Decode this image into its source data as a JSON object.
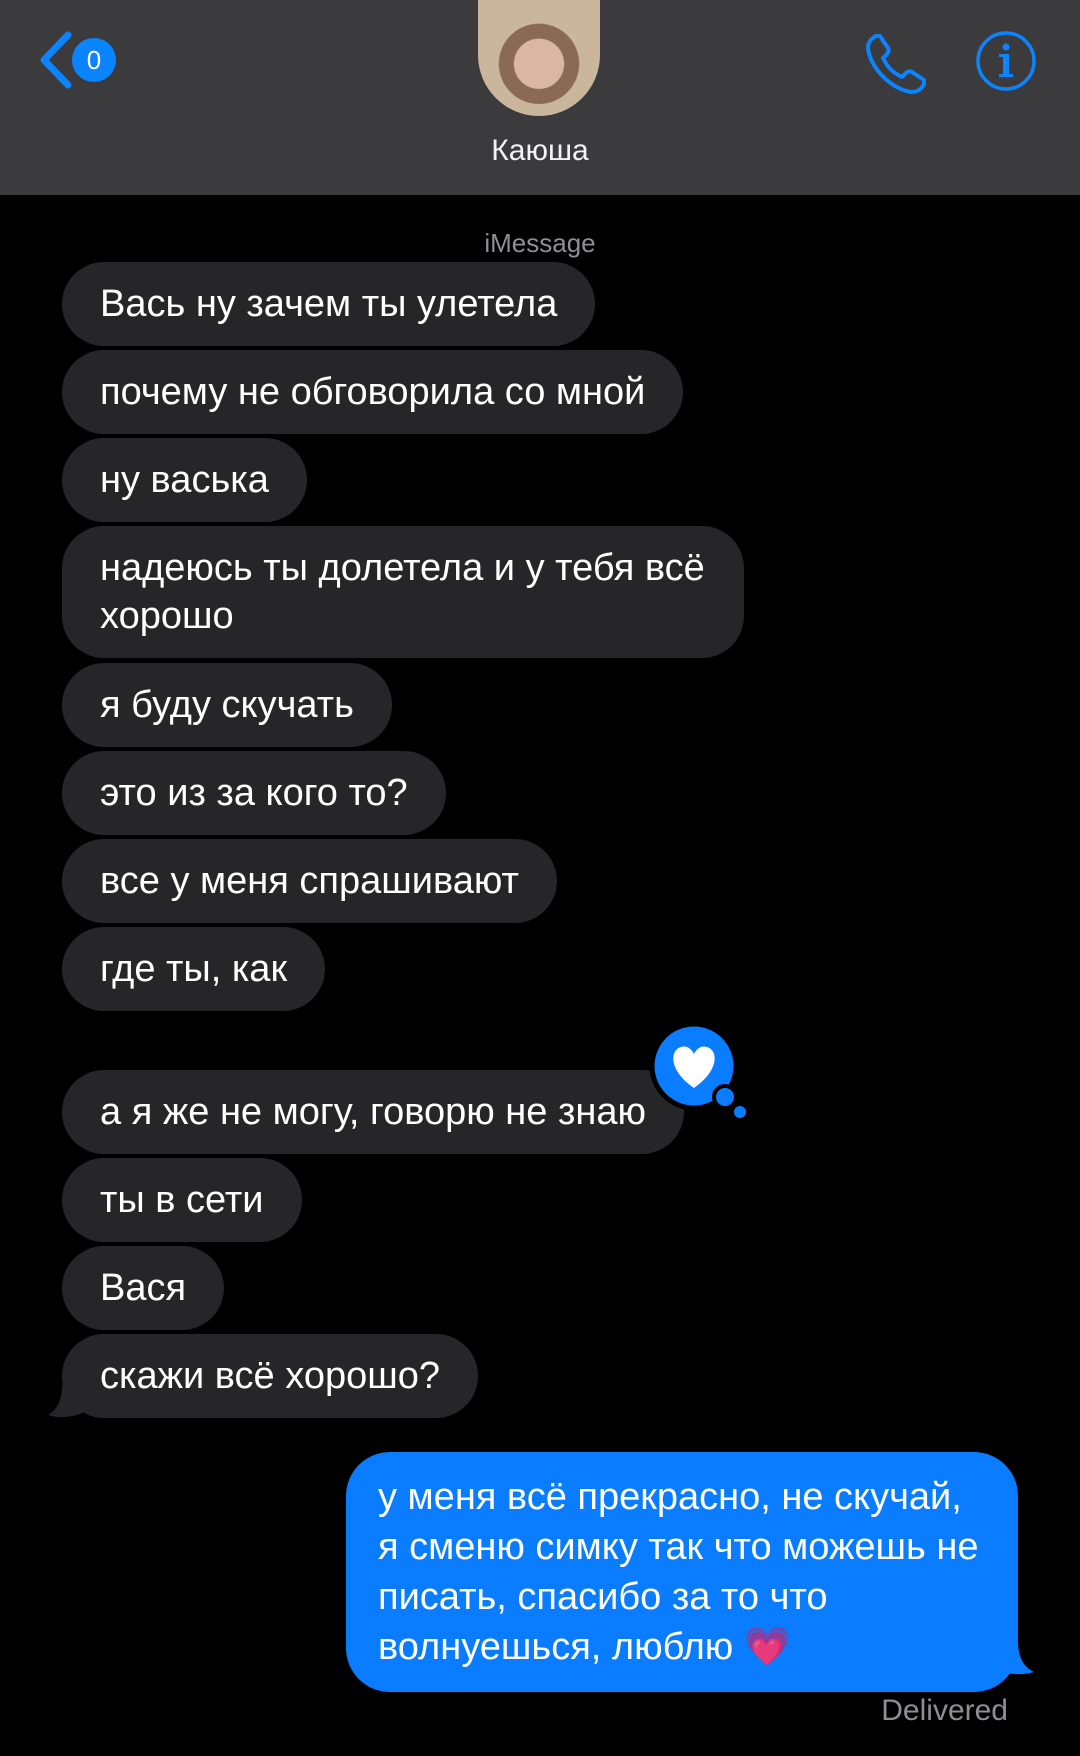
{
  "header": {
    "back_badge": "0",
    "contact_name": "Каюша",
    "accent_color": "#0a84ff",
    "icons": [
      "chevron-left-icon",
      "phone-icon",
      "info-icon"
    ]
  },
  "conversation": {
    "service_label": "iMessage",
    "incoming": [
      "Вась ну зачем ты улетела",
      "почему не обговорила со мной",
      "ну васька",
      "надеюсь ты долетела и у тебя всё хорошо",
      "я буду скучать",
      "это из за кого то?",
      "все у меня спрашивают",
      "где ты, как",
      "а я же не могу, говорю не знаю",
      "ты в сети",
      "Вася",
      "скажи всё хорошо?"
    ],
    "outgoing": "у меня всё прекрасно, не скучай, я сменю симку так что можешь не писать, спасибо за то что волнуешься, люблю 💗",
    "reaction_icon": "heart-icon",
    "status": "Delivered"
  }
}
